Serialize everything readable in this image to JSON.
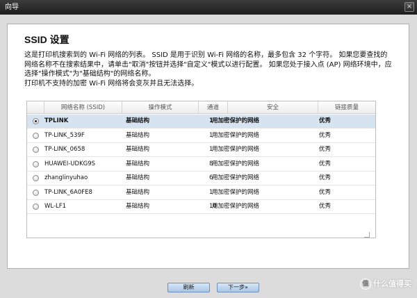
{
  "window": {
    "title": "向导",
    "close_glyph": "×"
  },
  "page": {
    "heading": "SSID 设置",
    "description": [
      "这是打印机搜索到的 Wi-Fi 网络的列表。 SSID 是用于识别 Wi-Fi 网络的名称，最多包含 32 个字符。 如果您要查找的",
      "网络名称不在搜索结果中，请单击\"取消\"按钮并选择\"自定义\"模式以进行配置。 如果您处于接入点 (AP) 网络环境中，应",
      "选择\"操作模式\"为\"基础结构\"的网络名称。",
      "打印机不支持的加密 Wi-Fi 网络将会变灰并且无法选择。"
    ]
  },
  "table": {
    "columns": [
      "",
      "网络名称 (SSID)",
      "操作模式",
      "通道",
      "安全",
      "链接质量"
    ],
    "rows": [
      {
        "selected": true,
        "ssid": "TPLINK",
        "mode": "基础结构",
        "channel": "1",
        "security": "用加密保护的网络",
        "quality": "优秀"
      },
      {
        "selected": false,
        "ssid": "TP-LINK_539F",
        "mode": "基础结构",
        "channel": "1",
        "security": "用加密保护的网络",
        "quality": "优秀"
      },
      {
        "selected": false,
        "ssid": "TP-LINK_0658",
        "mode": "基础结构",
        "channel": "1",
        "security": "用加密保护的网络",
        "quality": "优秀"
      },
      {
        "selected": false,
        "ssid": "HUAWEI-UDKG9S",
        "mode": "基础结构",
        "channel": "8",
        "security": "用加密保护的网络",
        "quality": "优秀"
      },
      {
        "selected": false,
        "ssid": "zhanglinyuhao",
        "mode": "基础结构",
        "channel": "6",
        "security": "用加密保护的网络",
        "quality": "优秀"
      },
      {
        "selected": false,
        "ssid": "TP-LINK_6A0FE8",
        "mode": "基础结构",
        "channel": "1",
        "security": "用加密保护的网络",
        "quality": "优秀"
      },
      {
        "selected": false,
        "ssid": "WL-LF1",
        "mode": "基础结构",
        "channel": "10",
        "security": "用加密保护的网络",
        "quality": "优秀"
      }
    ]
  },
  "buttons": {
    "refresh": "刷新",
    "next": "下一步»"
  },
  "watermark": {
    "icon": "值",
    "text": "什么值得买"
  },
  "colors": {
    "selected_row": "#d6e3f1",
    "button": "#a9c6e6",
    "titlebar": "#1e1e1e"
  }
}
